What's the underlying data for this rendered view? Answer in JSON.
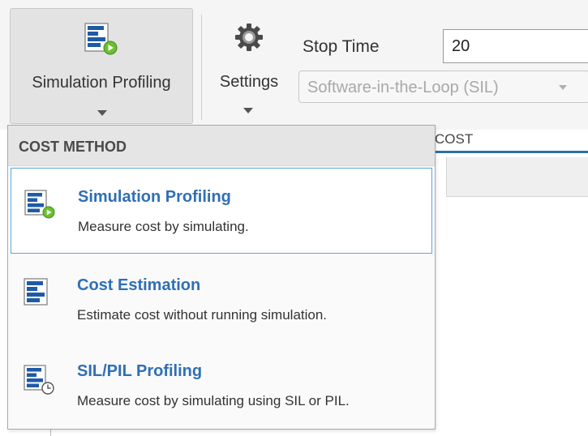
{
  "toolstrip": {
    "simulation_profiling_label": "Simulation Profiling",
    "settings_label": "Settings",
    "stop_time_label": "Stop Time",
    "stop_time_value": "20",
    "mode_selected": "Software-in-the-Loop (SIL)",
    "section_label": "COST"
  },
  "menu": {
    "header": "COST METHOD",
    "items": [
      {
        "title": "Simulation Profiling",
        "description": "Measure cost by simulating.",
        "icon": "simulation-profiling-icon",
        "selected": true
      },
      {
        "title": "Cost Estimation",
        "description": "Estimate cost without running simulation.",
        "icon": "cost-estimation-icon",
        "selected": false
      },
      {
        "title": "SIL/PIL Profiling",
        "description": "Measure cost by simulating using SIL or PIL.",
        "icon": "sil-pil-profiling-icon",
        "selected": false
      }
    ]
  },
  "colors": {
    "accent_blue": "#2f6fb5",
    "icon_blue": "#1f5aa6",
    "run_green": "#6cbf2f",
    "selection_border": "#5aa7dd"
  }
}
